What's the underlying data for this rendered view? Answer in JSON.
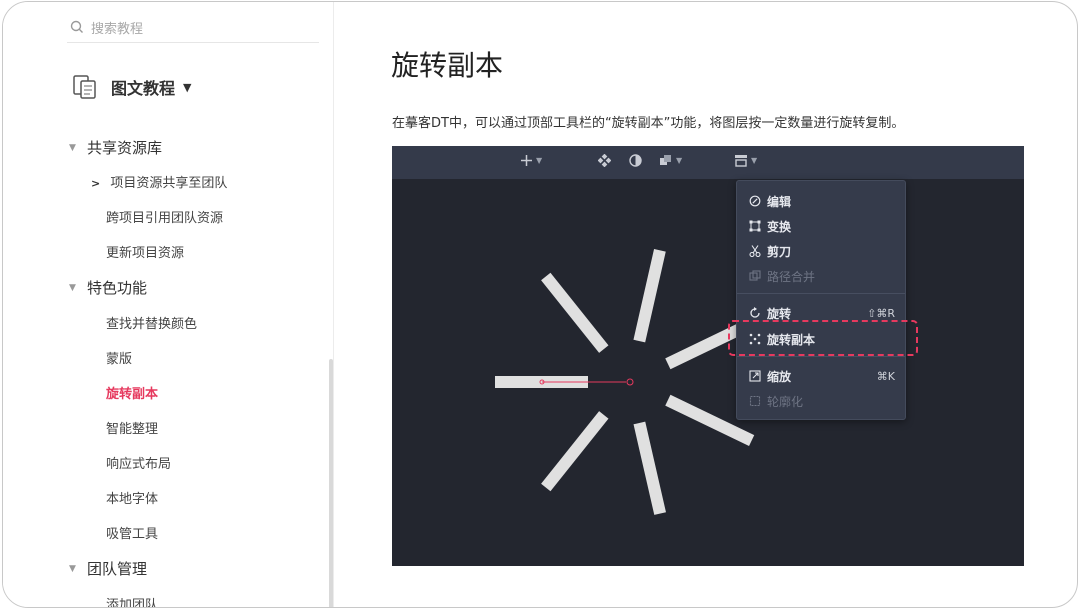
{
  "sidebar": {
    "search_placeholder": "搜索教程",
    "doc_title": "图文教程",
    "groups": [
      {
        "label": "共享资源库"
      },
      {
        "label": "特色功能"
      },
      {
        "label": "团队管理"
      }
    ],
    "items": [
      {
        "label": "项目资源共享至团队"
      },
      {
        "label": "跨项目引用团队资源"
      },
      {
        "label": "更新项目资源"
      },
      {
        "label": "查找并替换颜色"
      },
      {
        "label": "蒙版"
      },
      {
        "label": "旋转副本"
      },
      {
        "label": "智能整理"
      },
      {
        "label": "响应式布局"
      },
      {
        "label": "本地字体"
      },
      {
        "label": "吸管工具"
      },
      {
        "label": "添加团队"
      }
    ]
  },
  "main": {
    "title": "旋转副本",
    "description": "在摹客DT中，可以通过顶部工具栏的“旋转副本”功能，将图层按一定数量进行旋转复制。"
  },
  "menu": {
    "items": [
      {
        "label": "编辑",
        "shortcut": ""
      },
      {
        "label": "变换",
        "shortcut": ""
      },
      {
        "label": "剪刀",
        "shortcut": ""
      },
      {
        "label": "路径合并",
        "shortcut": ""
      },
      {
        "label": "旋转",
        "shortcut": "⇧⌘R"
      },
      {
        "label": "旋转副本",
        "shortcut": ""
      },
      {
        "label": "缩放",
        "shortcut": "⌘K"
      },
      {
        "label": "轮廓化",
        "shortcut": ""
      }
    ]
  },
  "colors": {
    "accent": "#e6395e",
    "canvas_bg": "#23262f",
    "toolbar_bg": "#343a4a",
    "menu_bg": "#353b4b"
  }
}
